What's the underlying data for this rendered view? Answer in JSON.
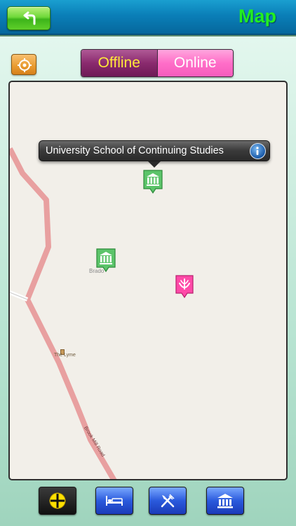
{
  "header": {
    "title": "Map",
    "back_icon": "back-arrow-icon"
  },
  "controls": {
    "locate_icon": "target-icon",
    "segment": {
      "selected": "Offline",
      "options": [
        "Offline",
        "Online"
      ]
    }
  },
  "map": {
    "callout": {
      "title": "University School of Continuing Studies",
      "info_icon": "info-icon"
    },
    "labels": {
      "town": "Brado",
      "place": "The Lyme",
      "road": "Brook Mill Road"
    },
    "pois": [
      {
        "name": "museum",
        "color": "#5cc46a"
      },
      {
        "name": "museum",
        "color": "#5cc46a"
      },
      {
        "name": "spa",
        "color": "#ff4aa8"
      }
    ]
  },
  "toolbar": {
    "buttons": [
      {
        "icon": "locate-all-icon",
        "selected": true
      },
      {
        "icon": "bed-icon"
      },
      {
        "icon": "fork-knife-icon"
      },
      {
        "icon": "museum-icon"
      }
    ]
  },
  "colors": {
    "header_bg": "#0a7fb8",
    "title": "#22ee22",
    "map_bg": "#f2efe9",
    "road": "#e8a0a0"
  }
}
